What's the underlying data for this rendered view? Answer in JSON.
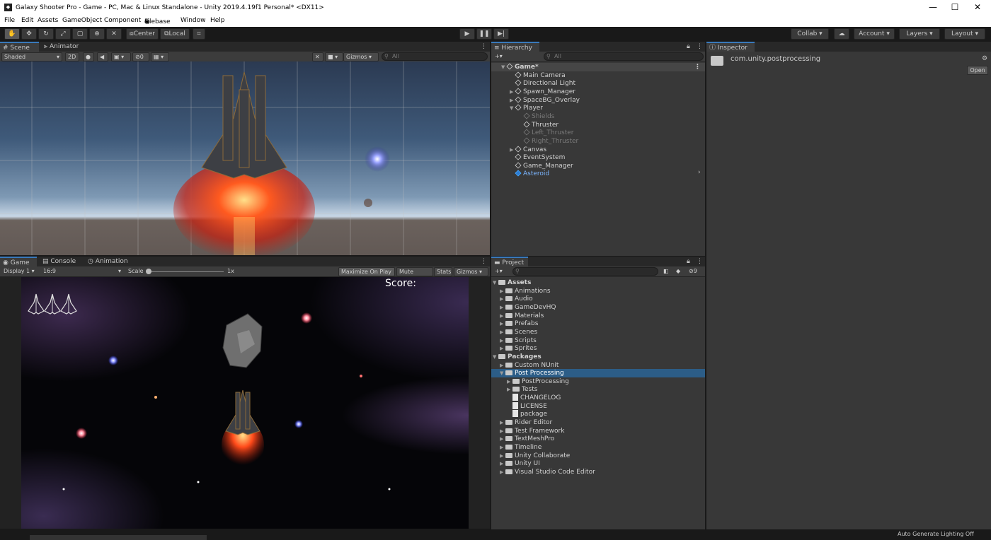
{
  "window": {
    "title": "Galaxy Shooter Pro - Game - PC, Mac & Linux Standalone - Unity 2019.4.19f1 Personal* <DX11>",
    "logo": "unity-icon",
    "min": "—",
    "max": "☐",
    "close": "✕"
  },
  "menu": [
    "File",
    "Edit",
    "Assets",
    "GameObject",
    "Component",
    "Filebase",
    "Window",
    "Help"
  ],
  "toolbar": {
    "pivot": "Center",
    "space": "Local",
    "collab": "Collab ▾",
    "account": "Account",
    "layers": "Layers",
    "layout": "Layout"
  },
  "scene": {
    "tabs": [
      "Scene",
      "Animator"
    ],
    "shading": "Shaded",
    "mode2d": "2D",
    "fx_count": "0",
    "gizmos": "Gizmos",
    "search_placeholder": "All"
  },
  "hierarchy": {
    "tab": "Hierarchy",
    "search_placeholder": "All",
    "items": [
      {
        "label": "Game*",
        "indent": 0,
        "type": "scene",
        "expand": "▼",
        "style": "bold"
      },
      {
        "label": "Main Camera",
        "indent": 1,
        "type": "go",
        "expand": "",
        "style": ""
      },
      {
        "label": "Directional Light",
        "indent": 1,
        "type": "go",
        "expand": "",
        "style": ""
      },
      {
        "label": "Spawn_Manager",
        "indent": 1,
        "type": "go",
        "expand": "▶",
        "style": ""
      },
      {
        "label": "SpaceBG_Overlay",
        "indent": 1,
        "type": "go",
        "expand": "▶",
        "style": ""
      },
      {
        "label": "Player",
        "indent": 1,
        "type": "go",
        "expand": "▼",
        "style": ""
      },
      {
        "label": "Shields",
        "indent": 2,
        "type": "go",
        "expand": "",
        "style": "dim"
      },
      {
        "label": "Thruster",
        "indent": 2,
        "type": "go",
        "expand": "",
        "style": ""
      },
      {
        "label": "Left_Thruster",
        "indent": 2,
        "type": "go",
        "expand": "",
        "style": "dim"
      },
      {
        "label": "Right_Thruster",
        "indent": 2,
        "type": "go",
        "expand": "",
        "style": "dim"
      },
      {
        "label": "Canvas",
        "indent": 1,
        "type": "go",
        "expand": "▶",
        "style": ""
      },
      {
        "label": "EventSystem",
        "indent": 1,
        "type": "go",
        "expand": "",
        "style": ""
      },
      {
        "label": "Game_Manager",
        "indent": 1,
        "type": "go",
        "expand": "",
        "style": ""
      },
      {
        "label": "Asteroid",
        "indent": 1,
        "type": "prefab",
        "expand": "",
        "style": "blue"
      }
    ]
  },
  "inspector": {
    "tab": "Inspector",
    "package": "com.unity.postprocessing",
    "open_button": "Open"
  },
  "game": {
    "tabs": [
      "Game",
      "Console",
      "Animation"
    ],
    "display": "Display 1",
    "aspect": "16:9",
    "scale_label": "Scale",
    "scale_value": "1x",
    "scale_fraction": 0.0,
    "maximize": "Maximize On Play",
    "mute": "Mute Audio",
    "stats": "Stats",
    "gizmos": "Gizmos",
    "score": "Score:",
    "lives": 3
  },
  "project": {
    "tab": "Project",
    "hidden_count": "9",
    "items": [
      {
        "label": "Assets",
        "indent": 0,
        "kind": "folder",
        "expand": "▼",
        "style": "bold"
      },
      {
        "label": "Animations",
        "indent": 1,
        "kind": "folder",
        "expand": "▶",
        "style": ""
      },
      {
        "label": "Audio",
        "indent": 1,
        "kind": "folder",
        "expand": "▶",
        "style": ""
      },
      {
        "label": "GameDevHQ",
        "indent": 1,
        "kind": "folder",
        "expand": "▶",
        "style": ""
      },
      {
        "label": "Materials",
        "indent": 1,
        "kind": "folder",
        "expand": "▶",
        "style": ""
      },
      {
        "label": "Prefabs",
        "indent": 1,
        "kind": "folder",
        "expand": "▶",
        "style": ""
      },
      {
        "label": "Scenes",
        "indent": 1,
        "kind": "folder",
        "expand": "▶",
        "style": ""
      },
      {
        "label": "Scripts",
        "indent": 1,
        "kind": "folder",
        "expand": "▶",
        "style": ""
      },
      {
        "label": "Sprites",
        "indent": 1,
        "kind": "folder",
        "expand": "▶",
        "style": ""
      },
      {
        "label": "Packages",
        "indent": 0,
        "kind": "folder",
        "expand": "▼",
        "style": "bold"
      },
      {
        "label": "Custom NUnit",
        "indent": 1,
        "kind": "folder",
        "expand": "▶",
        "style": ""
      },
      {
        "label": "Post Processing",
        "indent": 1,
        "kind": "folder",
        "expand": "▼",
        "style": "sel"
      },
      {
        "label": "PostProcessing",
        "indent": 2,
        "kind": "folder",
        "expand": "▶",
        "style": ""
      },
      {
        "label": "Tests",
        "indent": 2,
        "kind": "folder",
        "expand": "▶",
        "style": ""
      },
      {
        "label": "CHANGELOG",
        "indent": 2,
        "kind": "file",
        "expand": "",
        "style": ""
      },
      {
        "label": "LICENSE",
        "indent": 2,
        "kind": "file",
        "expand": "",
        "style": ""
      },
      {
        "label": "package",
        "indent": 2,
        "kind": "file",
        "expand": "",
        "style": ""
      },
      {
        "label": "Rider Editor",
        "indent": 1,
        "kind": "folder",
        "expand": "▶",
        "style": ""
      },
      {
        "label": "Test Framework",
        "indent": 1,
        "kind": "folder",
        "expand": "▶",
        "style": ""
      },
      {
        "label": "TextMeshPro",
        "indent": 1,
        "kind": "folder",
        "expand": "▶",
        "style": ""
      },
      {
        "label": "Timeline",
        "indent": 1,
        "kind": "folder",
        "expand": "▶",
        "style": ""
      },
      {
        "label": "Unity Collaborate",
        "indent": 1,
        "kind": "folder",
        "expand": "▶",
        "style": ""
      },
      {
        "label": "Unity UI",
        "indent": 1,
        "kind": "folder",
        "expand": "▶",
        "style": ""
      },
      {
        "label": "Visual Studio Code Editor",
        "indent": 1,
        "kind": "folder",
        "expand": "▶",
        "style": ""
      }
    ]
  },
  "status": {
    "lighting": "Auto Generate Lighting Off"
  }
}
